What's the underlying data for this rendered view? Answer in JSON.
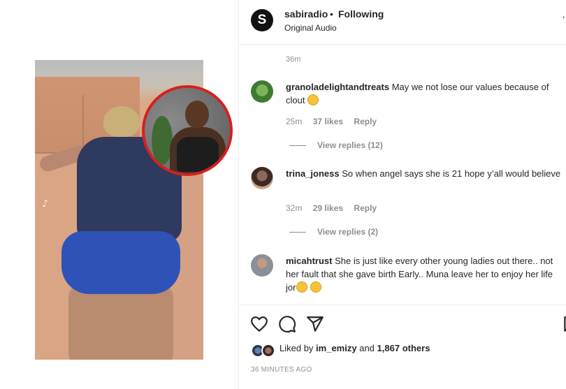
{
  "post": {
    "account": "sabiradio",
    "separator": "•",
    "follow_status": "Following",
    "audio": "Original Audio",
    "more": "·",
    "logo_letter": "S"
  },
  "comments": {
    "top_time": "36m",
    "items": [
      {
        "user": "granoladelightandtreats",
        "text": "May we not lose our values because of clout",
        "emoji": "slightly-smiling-face",
        "time": "25m",
        "likes": "37 likes",
        "reply": "Reply",
        "view_replies": "View replies (12)",
        "avatar_color": "#3f7a2f"
      },
      {
        "user": "trina_joness",
        "text": "So when angel says she is 21 hope y’all would believe",
        "time": "32m",
        "likes": "29 likes",
        "reply": "Reply",
        "view_replies": "View replies (2)",
        "avatar_color": "#6a5045"
      },
      {
        "user": "micahtrust",
        "text": "She is just like every other young ladies out there.. not her fault that she gave birth Early.. Muna leave her to enjoy her life jor",
        "emoji": "face-with-rolling-eyes",
        "avatar_color": "#8a8f98"
      }
    ]
  },
  "actions": {
    "icons": [
      "heart-icon",
      "comment-icon",
      "share-icon",
      "bookmark-icon"
    ],
    "liked_prefix": "Liked by",
    "liked_user": "im_emizy",
    "liked_and": "and",
    "liked_count": "1,867 others",
    "posted": "36 MINUTES AGO"
  },
  "colors": {
    "inset_border": "#d42020",
    "text": "#262626",
    "muted": "#8e8e8e"
  }
}
